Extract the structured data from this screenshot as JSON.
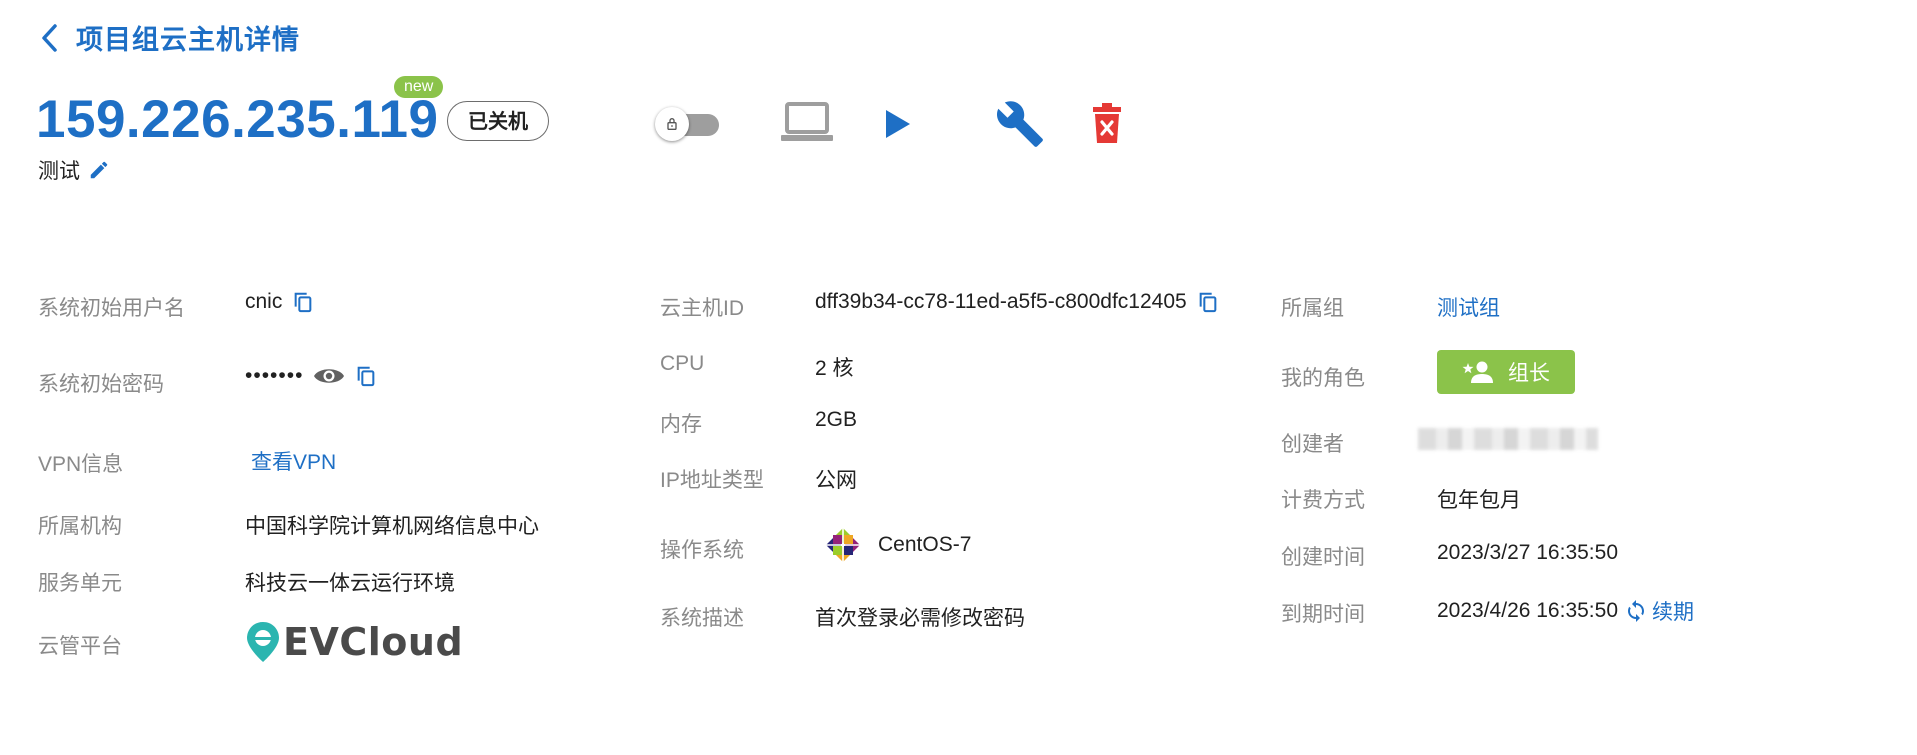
{
  "header": {
    "title": "项目组云主机详情"
  },
  "server": {
    "ip": "159.226.235.119",
    "new_badge": "new",
    "status": "已关机",
    "remark": "测试"
  },
  "toolbar": {
    "actions": [
      "lock-toggle",
      "remote-console",
      "start",
      "maintenance",
      "delete"
    ]
  },
  "col1": {
    "username_label": "系统初始用户名",
    "username": "cnic",
    "password_label": "系统初始密码",
    "password": "•••••••",
    "vpn_label": "VPN信息",
    "vpn_link": "查看VPN",
    "org_label": "所属机构",
    "org": "中国科学院计算机网络信息中心",
    "service_label": "服务单元",
    "service": "科技云一体云运行环境",
    "platform_label": "云管平台",
    "platform_logo_text": "EVCloud"
  },
  "col2": {
    "id_label": "云主机ID",
    "id": "dff39b34-cc78-11ed-a5f5-c800dfc12405",
    "cpu_label": "CPU",
    "cpu": "2 核",
    "mem_label": "内存",
    "mem": "2GB",
    "ip_type_label": "IP地址类型",
    "ip_type": "公网",
    "os_label": "操作系统",
    "os": "CentOS-7",
    "desc_label": "系统描述",
    "desc": "首次登录必需修改密码"
  },
  "col3": {
    "group_label": "所属组",
    "group": "测试组",
    "role_label": "我的角色",
    "role": "组长",
    "creator_label": "创建者",
    "billing_label": "计费方式",
    "billing": "包年包月",
    "created_label": "创建时间",
    "created": "2023/3/27 16:35:50",
    "expire_label": "到期时间",
    "expire": "2023/4/26 16:35:50",
    "renew": "续期"
  },
  "colors": {
    "primary": "#1e6fc5",
    "success": "#8bc34a",
    "danger": "#e53935",
    "label": "#8a8a8a"
  }
}
